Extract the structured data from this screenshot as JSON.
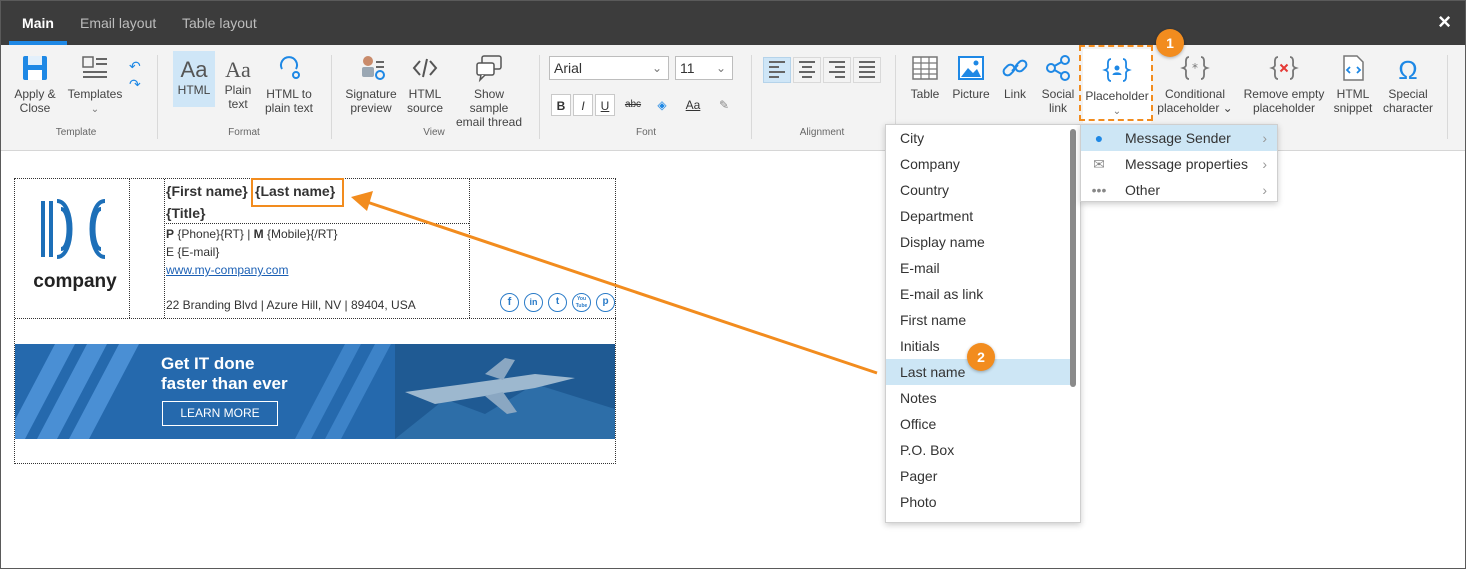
{
  "tabs": [
    {
      "label": "Main"
    },
    {
      "label": "Email layout"
    },
    {
      "label": "Table layout"
    }
  ],
  "close_label": "×",
  "ribbon": {
    "apply_close": "Apply &\nClose",
    "templates": "Templates",
    "templates_caret": "⌄",
    "group_template": "Template",
    "html": "HTML",
    "plain_text": "Plain\ntext",
    "html_to_plain": "HTML to\nplain text",
    "group_format": "Format",
    "signature_preview": "Signature\npreview",
    "html_source": "HTML\nsource",
    "show_sample": "Show sample\nemail thread",
    "group_view": "View",
    "font_name": "Arial",
    "font_size": "11",
    "bold": "B",
    "italic": "I",
    "underline": "U",
    "strike": "abc",
    "aa": "Aa",
    "group_font": "Font",
    "group_alignment": "Alignment",
    "table": "Table",
    "picture": "Picture",
    "link": "Link",
    "social_link": "Social\nlink",
    "placeholder": "Placeholder",
    "placeholder_caret": "⌄",
    "conditional_placeholder": "Conditional\nplaceholder ⌄",
    "remove_empty_placeholder": "Remove empty\nplaceholder",
    "html_snippet": "HTML\nsnippet",
    "special_character": "Special\ncharacter"
  },
  "signature": {
    "logo_text": "company",
    "first_name": "{First name}",
    "last_name": "{Last name}",
    "title": "{Title}",
    "phone_line_p": "P",
    "phone_line_rest": " {Phone}{RT} | ",
    "phone_line_m": "M",
    "phone_line_rest2": " {Mobile}{/RT}",
    "email_line": "E {E-mail}",
    "website": "www.my-company.com",
    "address": "22 Branding Blvd | Azure Hill, NV | 89404, USA",
    "social": [
      "f",
      "in",
      "t",
      "You Tube",
      "p"
    ],
    "banner_line1": "Get IT done",
    "banner_line2": "faster than ever",
    "banner_button": "LEARN MORE"
  },
  "placeholder_menu": {
    "items": [
      {
        "label": "City"
      },
      {
        "label": "Company"
      },
      {
        "label": "Country"
      },
      {
        "label": "Department"
      },
      {
        "label": "Display name"
      },
      {
        "label": "E-mail"
      },
      {
        "label": "E-mail as link"
      },
      {
        "label": "First name"
      },
      {
        "label": "Initials"
      },
      {
        "label": "Last name"
      },
      {
        "label": "Notes"
      },
      {
        "label": "Office"
      },
      {
        "label": "P.O. Box"
      },
      {
        "label": "Pager"
      },
      {
        "label": "Photo"
      }
    ],
    "highlighted": "Last name"
  },
  "category_menu": {
    "items": [
      {
        "label": "Message Sender",
        "icon": "person-icon"
      },
      {
        "label": "Message properties",
        "icon": "envelope-icon"
      },
      {
        "label": "Other",
        "icon": "ellipsis-icon"
      }
    ],
    "arrow": "›"
  },
  "badges": {
    "one": "1",
    "two": "2"
  },
  "colors": {
    "accent": "#1e88e5",
    "callout": "#f28c1e",
    "topbar": "#3c3c3c",
    "highlight": "#cde6f5"
  }
}
